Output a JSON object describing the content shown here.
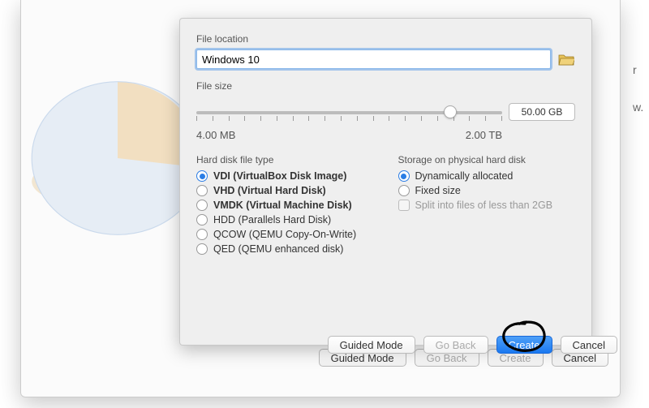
{
  "fileLocation": {
    "label": "File location",
    "value": "Windows 10"
  },
  "fileSize": {
    "label": "File size",
    "min": "4.00 MB",
    "max": "2.00 TB",
    "value": "50.00 GB"
  },
  "diskType": {
    "label": "Hard disk file type",
    "options": [
      {
        "label": "VDI (VirtualBox Disk Image)",
        "bold": true,
        "checked": true
      },
      {
        "label": "VHD (Virtual Hard Disk)",
        "bold": true,
        "checked": false
      },
      {
        "label": "VMDK (Virtual Machine Disk)",
        "bold": true,
        "checked": false
      },
      {
        "label": "HDD (Parallels Hard Disk)",
        "bold": false,
        "checked": false
      },
      {
        "label": "QCOW (QEMU Copy-On-Write)",
        "bold": false,
        "checked": false
      },
      {
        "label": "QED (QEMU enhanced disk)",
        "bold": false,
        "checked": false
      }
    ]
  },
  "storage": {
    "label": "Storage on physical hard disk",
    "options": [
      {
        "label": "Dynamically allocated",
        "checked": true
      },
      {
        "label": "Fixed size",
        "checked": false
      }
    ],
    "split": {
      "label": "Split into files of less than 2GB",
      "checked": false
    }
  },
  "buttons": {
    "guided": "Guided Mode",
    "back": "Go Back",
    "create": "Create",
    "cancel": "Cancel"
  },
  "bgCrumbs": {
    "a": "r",
    "b": "w."
  }
}
